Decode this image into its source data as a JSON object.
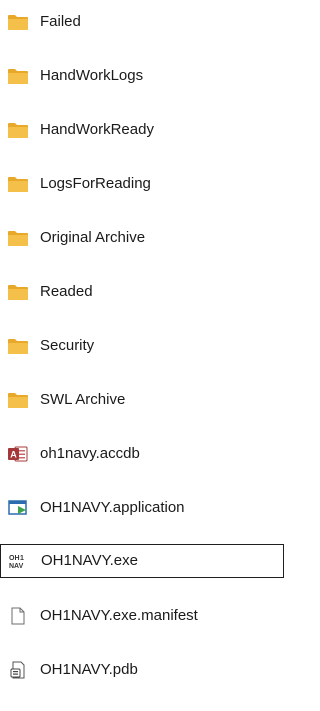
{
  "files": [
    {
      "name": "Failed",
      "icon": "folder-icon"
    },
    {
      "name": "HandWorkLogs",
      "icon": "folder-icon"
    },
    {
      "name": "HandWorkReady",
      "icon": "folder-icon"
    },
    {
      "name": "LogsForReading",
      "icon": "folder-icon"
    },
    {
      "name": "Original Archive",
      "icon": "folder-icon"
    },
    {
      "name": "Readed",
      "icon": "folder-icon"
    },
    {
      "name": "Security",
      "icon": "folder-icon"
    },
    {
      "name": "SWL Archive",
      "icon": "folder-icon"
    },
    {
      "name": "oh1navy.accdb",
      "icon": "access-database-icon"
    },
    {
      "name": "OH1NAVY.application",
      "icon": "application-manifest-icon"
    },
    {
      "name": "OH1NAVY.exe",
      "icon": "exe-app-icon",
      "selected": true
    },
    {
      "name": "OH1NAVY.exe.manifest",
      "icon": "blank-file-icon"
    },
    {
      "name": "OH1NAVY.pdb",
      "icon": "pdb-file-icon"
    }
  ],
  "colors": {
    "folder": "#f5c04a",
    "folder_tab": "#e8a92a",
    "access": "#a4373a",
    "app_blue": "#2b6cb0",
    "app_green": "#3fa34d",
    "selection_border": "#1f1f1f"
  }
}
